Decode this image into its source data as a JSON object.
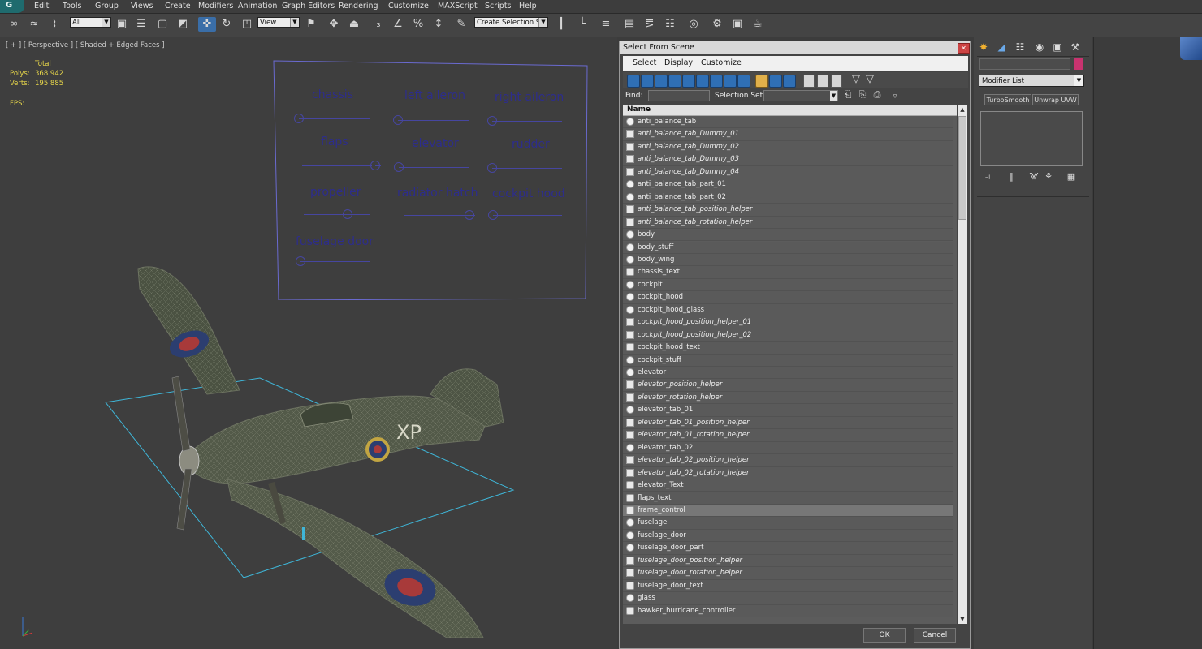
{
  "menubar": {
    "items": [
      "Edit",
      "Tools",
      "Group",
      "Views",
      "Create",
      "Modifiers",
      "Animation",
      "Graph Editors",
      "Rendering",
      "Customize",
      "MAXScript",
      "Scripts",
      "Help"
    ]
  },
  "toolbar": {
    "filter_value": "All",
    "refcoord_value": "View",
    "selection_set_value": "Create Selection Se"
  },
  "viewport": {
    "label": "[ + ] [ Perspective ] [ Shaded + Edged Faces ]",
    "stats": {
      "total_label": "Total",
      "polys_label": "Polys:",
      "polys_value": "368 942",
      "verts_label": "Verts:",
      "verts_value": "195 885",
      "fps_label": "FPS:"
    },
    "controls": [
      "chassis",
      "left aileron",
      "right aileron",
      "flaps",
      "elevator",
      "rudder",
      "propeller",
      "radiator hatch",
      "cockpit hood",
      "fuselage door"
    ],
    "slider_positions": [
      0.0,
      0.0,
      0.0,
      1.0,
      0.0,
      0.0,
      0.65,
      0.95,
      0.0,
      0.0
    ],
    "plane_marking": "XP"
  },
  "dialog": {
    "title": "Select From Scene",
    "menus": [
      "Select",
      "Display",
      "Customize"
    ],
    "find_label": "Find:",
    "find_value": "",
    "selection_set_label": "Selection Set:",
    "column_name": "Name",
    "ok_label": "OK",
    "cancel_label": "Cancel",
    "rows": [
      {
        "name": "anti_balance_tab",
        "type": "geo"
      },
      {
        "name": "anti_balance_tab_Dummy_01",
        "type": "helper"
      },
      {
        "name": "anti_balance_tab_Dummy_02",
        "type": "helper"
      },
      {
        "name": "anti_balance_tab_Dummy_03",
        "type": "helper"
      },
      {
        "name": "anti_balance_tab_Dummy_04",
        "type": "helper"
      },
      {
        "name": "anti_balance_tab_part_01",
        "type": "geo"
      },
      {
        "name": "anti_balance_tab_part_02",
        "type": "geo"
      },
      {
        "name": "anti_balance_tab_position_helper",
        "type": "helper"
      },
      {
        "name": "anti_balance_tab_rotation_helper",
        "type": "helper"
      },
      {
        "name": "body",
        "type": "geo"
      },
      {
        "name": "body_stuff",
        "type": "geo"
      },
      {
        "name": "body_wing",
        "type": "geo"
      },
      {
        "name": "chassis_text",
        "type": "shape"
      },
      {
        "name": "cockpit",
        "type": "geo"
      },
      {
        "name": "cockpit_hood",
        "type": "geo"
      },
      {
        "name": "cockpit_hood_glass",
        "type": "geo"
      },
      {
        "name": "cockpit_hood_position_helper_01",
        "type": "helper"
      },
      {
        "name": "cockpit_hood_position_helper_02",
        "type": "helper"
      },
      {
        "name": "cockpit_hood_text",
        "type": "shape"
      },
      {
        "name": "cockpit_stuff",
        "type": "geo"
      },
      {
        "name": "elevator",
        "type": "geo"
      },
      {
        "name": "elevator_position_helper",
        "type": "helper"
      },
      {
        "name": "elevator_rotation_helper",
        "type": "helper"
      },
      {
        "name": "elevator_tab_01",
        "type": "geo"
      },
      {
        "name": "elevator_tab_01_position_helper",
        "type": "helper"
      },
      {
        "name": "elevator_tab_01_rotation_helper",
        "type": "helper"
      },
      {
        "name": "elevator_tab_02",
        "type": "geo"
      },
      {
        "name": "elevator_tab_02_position_helper",
        "type": "helper"
      },
      {
        "name": "elevator_tab_02_rotation_helper",
        "type": "helper"
      },
      {
        "name": "elevator_Text",
        "type": "shape"
      },
      {
        "name": "flaps_text",
        "type": "shape"
      },
      {
        "name": "frame_control",
        "type": "shape",
        "selected": true
      },
      {
        "name": "fuselage",
        "type": "geo"
      },
      {
        "name": "fuselage_door",
        "type": "geo"
      },
      {
        "name": "fuselage_door_part",
        "type": "geo"
      },
      {
        "name": "fuselage_door_position_helper",
        "type": "helper"
      },
      {
        "name": "fuselage_door_rotation_helper",
        "type": "helper"
      },
      {
        "name": "fuselage_door_text",
        "type": "shape"
      },
      {
        "name": "glass",
        "type": "geo"
      },
      {
        "name": "hawker_hurricane_controller",
        "type": "shape"
      }
    ]
  },
  "command_panel": {
    "modifier_list": "Modifier List",
    "buttons": [
      "TurboSmooth",
      "Unwrap UVW"
    ],
    "object_color": "#c8336f"
  }
}
